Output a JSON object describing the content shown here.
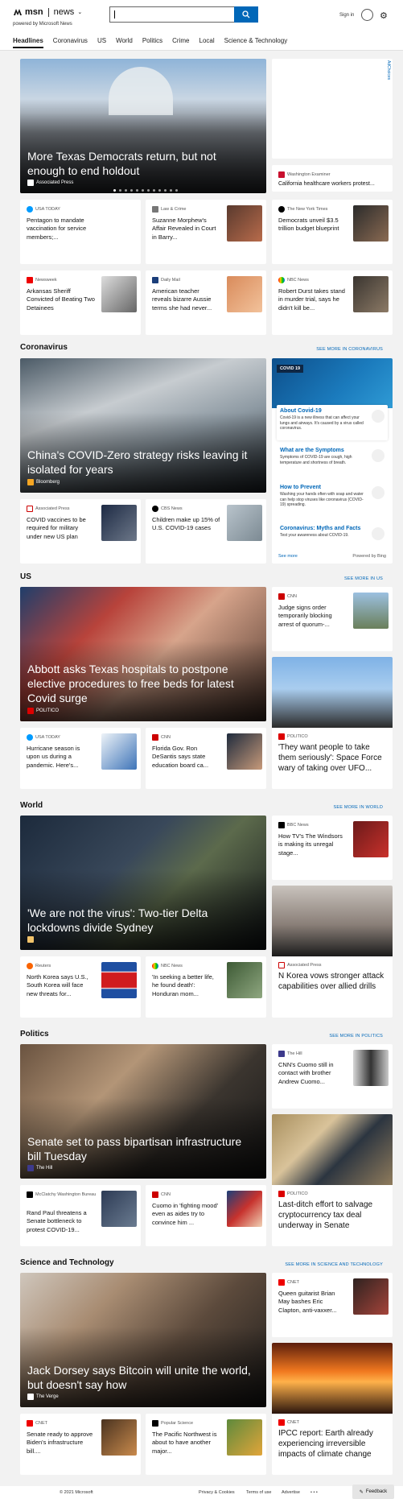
{
  "header": {
    "brand": "msn",
    "section": "news",
    "powered": "powered by Microsoft News",
    "signin": "Sign in"
  },
  "nav": [
    "Headlines",
    "Coronavirus",
    "US",
    "World",
    "Politics",
    "Crime",
    "Local",
    "Science & Technology"
  ],
  "headlines": {
    "hero": {
      "title": "More Texas Democrats return, but not enough to end holdout",
      "source": "Associated Press"
    },
    "ad_choices": "AdChoices",
    "wide": {
      "source": "Washington Examiner",
      "title": "California healthcare workers protest..."
    },
    "cards": [
      {
        "source": "USA TODAY",
        "title": "Pentagon to mandate vaccination for service members;..."
      },
      {
        "source": "Law & Crime",
        "title": "Suzanne Morphew's Affair Revealed in Court in Barry..."
      },
      {
        "source": "The New York Times",
        "title": "Democrats unveil $3.5 trillion budget blueprint"
      },
      {
        "source": "Newsweek",
        "title": "Arkansas Sheriff Convicted of Beating Two Detainees"
      },
      {
        "source": "Daily Mail",
        "title": "American teacher reveals bizarre Aussie terms she had never..."
      },
      {
        "source": "NBC News",
        "title": "Robert Durst takes stand in murder trial, says he didn't kill be..."
      }
    ]
  },
  "coronavirus": {
    "title": "Coronavirus",
    "more": "SEE MORE IN CORONAVIRUS",
    "hero": {
      "title": "China's COVID-Zero strategy risks leaving it isolated for years",
      "source": "Bloomberg"
    },
    "cards": [
      {
        "source": "Associated Press",
        "title": "COVID vaccines to be required for military under new US plan"
      },
      {
        "source": "CBS News",
        "title": "Children make up 15% of U.S. COVID-19 cases"
      }
    ],
    "panel": {
      "tag": "COVID 19",
      "items": [
        {
          "title": "About Covid-19",
          "desc": "Covid-19 is a new illness that can affect your lungs and airways. It's caused by a virus called coronavirus."
        },
        {
          "title": "What are the Symptoms",
          "desc": "Symptoms of COVID-19 are cough, high temperature and shortness of breath."
        },
        {
          "title": "How to Prevent",
          "desc": "Washing your hands often with soap and water can help stop viruses like coronavirus (COVID-19) spreading."
        },
        {
          "title": "Coronavirus: Myths and Facts",
          "desc": "Test your awareness about COVID-19."
        }
      ],
      "more": "See more",
      "powered": "Powered by Bing"
    }
  },
  "us": {
    "title": "US",
    "more": "SEE MORE IN US",
    "hero": {
      "title": "Abbott asks Texas hospitals to postpone elective procedures to free beds for latest Covid surge",
      "source": "POLITICO"
    },
    "side_small": {
      "source": "CNN",
      "title": "Judge signs order temporarily blocking arrest of quorum-..."
    },
    "side_big": {
      "source": "POLITICO",
      "title": "'They want people to take them seriously': Space Force wary of taking over UFO..."
    },
    "cards": [
      {
        "source": "USA TODAY",
        "title": "Hurricane season is upon us during a pandemic. Here's..."
      },
      {
        "source": "CNN",
        "title": "Florida Gov. Ron DeSantis says state education board ca..."
      }
    ]
  },
  "world": {
    "title": "World",
    "more": "SEE MORE IN WORLD",
    "hero": {
      "title": "'We are not the virus': Two-tier Delta lockdowns divide Sydney",
      "source": ""
    },
    "side_small": {
      "source": "BBC News",
      "title": "How TV's The Windsors is making its unregal stage..."
    },
    "side_big": {
      "source": "Associated Press",
      "title": "N Korea vows stronger attack capabilities over allied drills"
    },
    "cards": [
      {
        "source": "Reuters",
        "title": "North Korea says U.S., South Korea will face new threats for..."
      },
      {
        "source": "NBC News",
        "title": "'In seeking a better life, he found death': Honduran mom..."
      }
    ]
  },
  "politics": {
    "title": "Politics",
    "more": "SEE MORE IN POLITICS",
    "hero": {
      "title": "Senate set to pass bipartisan infrastructure bill Tuesday",
      "source": "The Hill"
    },
    "side_small": {
      "source": "The Hill",
      "title": "CNN's Cuomo still in contact with brother Andrew Cuomo..."
    },
    "side_big": {
      "source": "POLITICO",
      "title": "Last-ditch effort to salvage cryptocurrency tax deal underway in Senate"
    },
    "cards": [
      {
        "source": "McClatchy Washington Bureau",
        "title": "Rand Paul threatens a Senate bottleneck to protest COVID-19..."
      },
      {
        "source": "CNN",
        "title": "Cuomo in 'fighting mood' even as aides try to convince him ..."
      }
    ]
  },
  "science": {
    "title": "Science and Technology",
    "more": "SEE MORE IN SCIENCE AND TECHNOLOGY",
    "hero": {
      "title": "Jack Dorsey says Bitcoin will unite the world, but doesn't say how",
      "source": "The Verge"
    },
    "side_small": {
      "source": "CNET",
      "title": "Queen guitarist Brian May bashes Eric Clapton, anti-vaxxer..."
    },
    "side_big": {
      "source": "CNET",
      "title": "IPCC report: Earth already experiencing irreversible impacts of climate change"
    },
    "cards": [
      {
        "source": "CNET",
        "title": "Senate ready to approve Biden's infrastructure bill...."
      },
      {
        "source": "Popular Science",
        "title": "The Pacific Northwest is about to have another major..."
      }
    ]
  },
  "footer": {
    "copyright": "© 2021 Microsoft",
    "privacy": "Privacy & Cookies",
    "terms": "Terms of use",
    "advertise": "Advertise",
    "ellipsis": "• • •",
    "feedback": "Feedback"
  }
}
